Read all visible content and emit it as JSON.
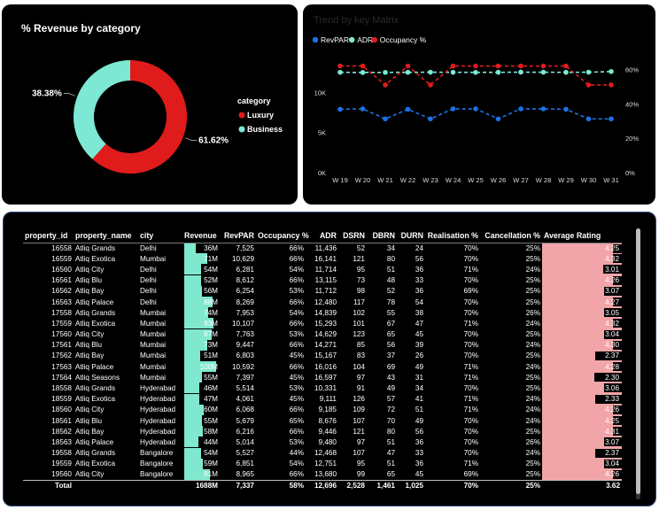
{
  "donut": {
    "title": "% Revenue by category",
    "legend_title": "category",
    "colors": {
      "Luxury": "#e01b1b",
      "Business": "#7de8d4"
    },
    "chart_data": {
      "type": "pie",
      "title": "% Revenue by category",
      "categories": [
        "Luxury",
        "Business"
      ],
      "values": [
        61.62,
        38.38
      ],
      "labels": [
        "61.62%",
        "38.38%"
      ],
      "legend": "right"
    }
  },
  "trend": {
    "title": "Trend by key Matrix",
    "chart_data": {
      "type": "line",
      "title": "Trend by key Matrix",
      "x": [
        "W 19",
        "W 20",
        "W 21",
        "W 22",
        "W 23",
        "W 24",
        "W 25",
        "W 26",
        "W 27",
        "W 28",
        "W 29",
        "W 30",
        "W 31"
      ],
      "y_left_ticks": [
        "0K",
        "5K",
        "10K"
      ],
      "y_left_range": [
        0,
        15000
      ],
      "y_right_ticks": [
        "0%",
        "20%",
        "40%",
        "60%"
      ],
      "y_right_range": [
        0,
        0.7
      ],
      "legend": "top-left",
      "series": [
        {
          "name": "RevPAR",
          "axis": "left",
          "color": "#1a73e8",
          "values": [
            7900,
            7950,
            6700,
            7900,
            6700,
            7950,
            7950,
            6700,
            7950,
            7950,
            7900,
            6700,
            6700
          ]
        },
        {
          "name": "ADR",
          "axis": "left",
          "color": "#7de8d4",
          "values": [
            12500,
            12480,
            12490,
            12500,
            12510,
            12500,
            12490,
            12500,
            12520,
            12510,
            12500,
            12510,
            12600
          ]
        },
        {
          "name": "Occupancy %",
          "axis": "right",
          "color": "#e01b1b",
          "values": [
            0.62,
            0.62,
            0.51,
            0.62,
            0.51,
            0.62,
            0.62,
            0.62,
            0.62,
            0.62,
            0.62,
            0.51,
            0.51
          ]
        }
      ]
    }
  },
  "table": {
    "headers": [
      "property_id",
      "property_name",
      "city",
      "Revenue",
      "RevPAR",
      "Occupancy %",
      "ADR",
      "DSRN",
      "DBRN",
      "DURN",
      "Realisation %",
      "Cancellation %",
      "Average Rating"
    ],
    "rows": [
      {
        "property_id": "16558",
        "property_name": "Atliq Grands",
        "city": "Delhi",
        "revenue": "36M",
        "revenue_val": 36,
        "revpar": "7,525",
        "occupancy": "66%",
        "adr": "11,436",
        "dsrn": "52",
        "dbrn": "34",
        "durn": "24",
        "realisation": "70%",
        "cancellation": "25%",
        "rating": "4.25",
        "rating_val": 4.25
      },
      {
        "property_id": "16559",
        "property_name": "Atliq Exotica",
        "city": "Mumbai",
        "revenue": "71M",
        "revenue_val": 71,
        "revpar": "10,629",
        "occupancy": "66%",
        "adr": "16,141",
        "dsrn": "121",
        "dbrn": "80",
        "durn": "56",
        "realisation": "70%",
        "cancellation": "25%",
        "rating": "4.32",
        "rating_val": 4.32
      },
      {
        "property_id": "16560",
        "property_name": "Atliq City",
        "city": "Delhi",
        "revenue": "54M",
        "revenue_val": 54,
        "revpar": "6,281",
        "occupancy": "54%",
        "adr": "11,714",
        "dsrn": "95",
        "dbrn": "51",
        "durn": "36",
        "realisation": "71%",
        "cancellation": "24%",
        "rating": "3.01",
        "rating_val": 3.01
      },
      {
        "property_id": "16561",
        "property_name": "Atliq Blu",
        "city": "Delhi",
        "revenue": "52M",
        "revenue_val": 52,
        "revpar": "8,612",
        "occupancy": "66%",
        "adr": "13,115",
        "dsrn": "73",
        "dbrn": "48",
        "durn": "33",
        "realisation": "70%",
        "cancellation": "25%",
        "rating": "4.26",
        "rating_val": 4.26
      },
      {
        "property_id": "16562",
        "property_name": "Atliq Bay",
        "city": "Delhi",
        "revenue": "56M",
        "revenue_val": 56,
        "revpar": "6,254",
        "occupancy": "53%",
        "adr": "11,712",
        "dsrn": "98",
        "dbrn": "52",
        "durn": "36",
        "realisation": "69%",
        "cancellation": "25%",
        "rating": "3.07",
        "rating_val": 3.07
      },
      {
        "property_id": "16563",
        "property_name": "Atliq Palace",
        "city": "Delhi",
        "revenue": "88M",
        "revenue_val": 88,
        "revpar": "8,269",
        "occupancy": "66%",
        "adr": "12,480",
        "dsrn": "117",
        "dbrn": "78",
        "durn": "54",
        "realisation": "70%",
        "cancellation": "25%",
        "rating": "4.27",
        "rating_val": 4.27
      },
      {
        "property_id": "17558",
        "property_name": "Atliq Grands",
        "city": "Mumbai",
        "revenue": "74M",
        "revenue_val": 74,
        "revpar": "7,953",
        "occupancy": "54%",
        "adr": "14,839",
        "dsrn": "102",
        "dbrn": "55",
        "durn": "38",
        "realisation": "70%",
        "cancellation": "26%",
        "rating": "3.05",
        "rating_val": 3.05
      },
      {
        "property_id": "17559",
        "property_name": "Atliq Exotica",
        "city": "Mumbai",
        "revenue": "93M",
        "revenue_val": 93,
        "revpar": "10,107",
        "occupancy": "66%",
        "adr": "15,293",
        "dsrn": "101",
        "dbrn": "67",
        "durn": "47",
        "realisation": "71%",
        "cancellation": "24%",
        "rating": "4.32",
        "rating_val": 4.32
      },
      {
        "property_id": "17560",
        "property_name": "Atliq City",
        "city": "Mumbai",
        "revenue": "87M",
        "revenue_val": 87,
        "revpar": "7,763",
        "occupancy": "53%",
        "adr": "14,629",
        "dsrn": "123",
        "dbrn": "65",
        "durn": "45",
        "realisation": "70%",
        "cancellation": "25%",
        "rating": "3.04",
        "rating_val": 3.04
      },
      {
        "property_id": "17561",
        "property_name": "Atliq Blu",
        "city": "Mumbai",
        "revenue": "73M",
        "revenue_val": 73,
        "revpar": "9,447",
        "occupancy": "66%",
        "adr": "14,271",
        "dsrn": "85",
        "dbrn": "56",
        "durn": "39",
        "realisation": "70%",
        "cancellation": "24%",
        "rating": "4.30",
        "rating_val": 4.3
      },
      {
        "property_id": "17562",
        "property_name": "Atliq Bay",
        "city": "Mumbai",
        "revenue": "51M",
        "revenue_val": 51,
        "revpar": "6,803",
        "occupancy": "45%",
        "adr": "15,167",
        "dsrn": "83",
        "dbrn": "37",
        "durn": "26",
        "realisation": "70%",
        "cancellation": "25%",
        "rating": "2.37",
        "rating_val": 2.37
      },
      {
        "property_id": "17563",
        "property_name": "Atliq Palace",
        "city": "Mumbai",
        "revenue": "100M",
        "revenue_val": 100,
        "revpar": "10,592",
        "occupancy": "66%",
        "adr": "16,016",
        "dsrn": "104",
        "dbrn": "69",
        "durn": "49",
        "realisation": "71%",
        "cancellation": "24%",
        "rating": "4.28",
        "rating_val": 4.28
      },
      {
        "property_id": "17564",
        "property_name": "Atliq Seasons",
        "city": "Mumbai",
        "revenue": "55M",
        "revenue_val": 55,
        "revpar": "7,397",
        "occupancy": "45%",
        "adr": "16,597",
        "dsrn": "97",
        "dbrn": "43",
        "durn": "31",
        "realisation": "71%",
        "cancellation": "25%",
        "rating": "2.30",
        "rating_val": 2.3
      },
      {
        "property_id": "18558",
        "property_name": "Atliq Grands",
        "city": "Hyderabad",
        "revenue": "46M",
        "revenue_val": 46,
        "revpar": "5,514",
        "occupancy": "53%",
        "adr": "10,331",
        "dsrn": "91",
        "dbrn": "49",
        "durn": "34",
        "realisation": "70%",
        "cancellation": "25%",
        "rating": "3.06",
        "rating_val": 3.06
      },
      {
        "property_id": "18559",
        "property_name": "Atliq Exotica",
        "city": "Hyderabad",
        "revenue": "47M",
        "revenue_val": 47,
        "revpar": "4,061",
        "occupancy": "45%",
        "adr": "9,111",
        "dsrn": "126",
        "dbrn": "57",
        "durn": "41",
        "realisation": "71%",
        "cancellation": "24%",
        "rating": "2.33",
        "rating_val": 2.33
      },
      {
        "property_id": "18560",
        "property_name": "Atliq City",
        "city": "Hyderabad",
        "revenue": "60M",
        "revenue_val": 60,
        "revpar": "6,068",
        "occupancy": "66%",
        "adr": "9,185",
        "dsrn": "109",
        "dbrn": "72",
        "durn": "51",
        "realisation": "71%",
        "cancellation": "24%",
        "rating": "4.26",
        "rating_val": 4.26
      },
      {
        "property_id": "18561",
        "property_name": "Atliq Blu",
        "city": "Hyderabad",
        "revenue": "55M",
        "revenue_val": 55,
        "revpar": "5,679",
        "occupancy": "65%",
        "adr": "8,676",
        "dsrn": "107",
        "dbrn": "70",
        "durn": "49",
        "realisation": "70%",
        "cancellation": "24%",
        "rating": "4.25",
        "rating_val": 4.25
      },
      {
        "property_id": "18562",
        "property_name": "Atliq Bay",
        "city": "Hyderabad",
        "revenue": "58M",
        "revenue_val": 58,
        "revpar": "6,216",
        "occupancy": "66%",
        "adr": "9,446",
        "dsrn": "121",
        "dbrn": "80",
        "durn": "56",
        "realisation": "70%",
        "cancellation": "25%",
        "rating": "4.31",
        "rating_val": 4.31
      },
      {
        "property_id": "18563",
        "property_name": "Atliq Palace",
        "city": "Hyderabad",
        "revenue": "44M",
        "revenue_val": 44,
        "revpar": "5,014",
        "occupancy": "53%",
        "adr": "9,480",
        "dsrn": "97",
        "dbrn": "51",
        "durn": "36",
        "realisation": "70%",
        "cancellation": "26%",
        "rating": "3.07",
        "rating_val": 3.07
      },
      {
        "property_id": "19558",
        "property_name": "Atliq Grands",
        "city": "Bangalore",
        "revenue": "54M",
        "revenue_val": 54,
        "revpar": "5,527",
        "occupancy": "44%",
        "adr": "12,468",
        "dsrn": "107",
        "dbrn": "47",
        "durn": "33",
        "realisation": "70%",
        "cancellation": "24%",
        "rating": "2.37",
        "rating_val": 2.37
      },
      {
        "property_id": "19559",
        "property_name": "Atliq Exotica",
        "city": "Bangalore",
        "revenue": "59M",
        "revenue_val": 59,
        "revpar": "6,851",
        "occupancy": "54%",
        "adr": "12,751",
        "dsrn": "95",
        "dbrn": "51",
        "durn": "36",
        "realisation": "71%",
        "cancellation": "25%",
        "rating": "3.04",
        "rating_val": 3.04
      },
      {
        "property_id": "19560",
        "property_name": "Atliq City",
        "city": "Bangalore",
        "revenue": "81M",
        "revenue_val": 81,
        "revpar": "8,965",
        "occupancy": "66%",
        "adr": "13,680",
        "dsrn": "99",
        "dbrn": "65",
        "durn": "45",
        "realisation": "69%",
        "cancellation": "25%",
        "rating": "4.26",
        "rating_val": 4.26
      }
    ],
    "total": {
      "label": "Total",
      "revenue": "1688M",
      "revpar": "7,337",
      "occupancy": "58%",
      "adr": "12,696",
      "dsrn": "2,528",
      "dbrn": "1,461",
      "durn": "1,025",
      "realisation": "70%",
      "cancellation": "25%",
      "rating": "3.62"
    }
  }
}
